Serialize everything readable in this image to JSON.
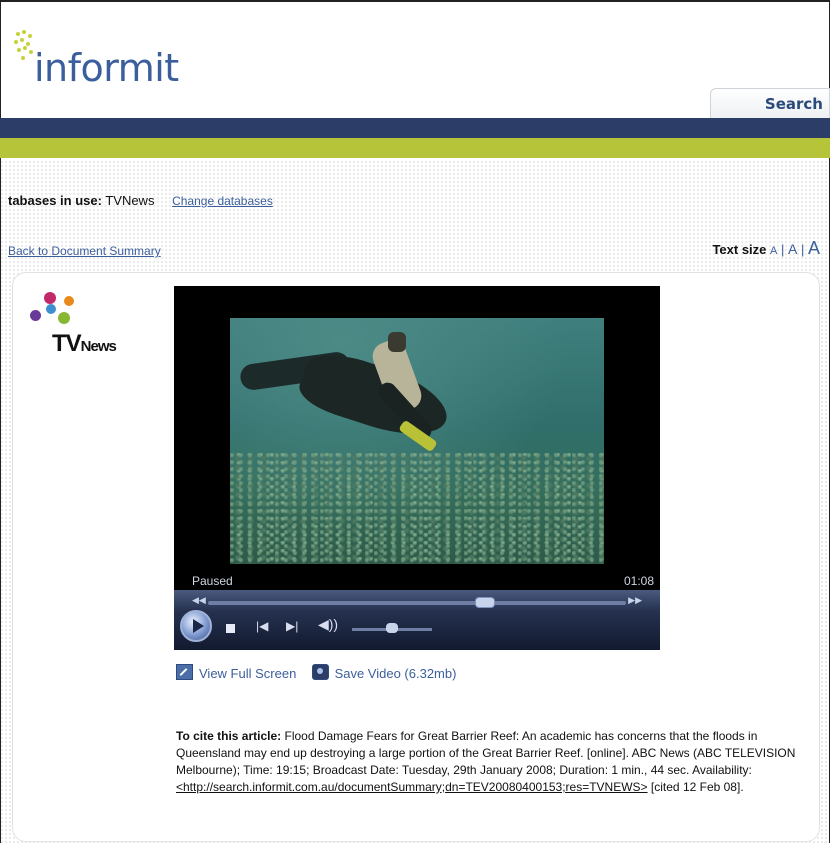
{
  "header": {
    "logo_text": "informit",
    "search_tab_label": "Search"
  },
  "databases": {
    "label": "tabases in use:",
    "value": "TVNews",
    "change_link": "Change databases"
  },
  "nav": {
    "back_link": "Back to Document Summary",
    "text_size_label": "Text size",
    "text_size_options": [
      "A",
      "A",
      "A"
    ]
  },
  "source_logo": {
    "text_tv": "TV",
    "text_news": "News"
  },
  "player": {
    "status": "Paused",
    "time": "01:08",
    "seek_progress": 0.66,
    "volume_level": 0.5
  },
  "actions": {
    "full_screen": "View Full Screen",
    "save_video": "Save Video (6.32mb)"
  },
  "citation": {
    "label": "To cite this article:",
    "text": "Flood Damage Fears for Great Barrier Reef: An academic has concerns that the floods in Queensland may end up destroying a large portion of the Great Barrier Reef. [online]. ABC News (ABC TELEVISION Melbourne); Time: 19:15; Broadcast Date: Tuesday, 29th January 2008; Duration: 1 min., 44 sec. Availability:",
    "url": "<http://search.informit.com.au/documentSummary;dn=TEV20080400153;res=TVNEWS>",
    "cited": "[cited 12 Feb 08]."
  },
  "colors": {
    "navy_band": "#2c3d68",
    "lime_band": "#b6c43a",
    "link": "#3b5f9c"
  }
}
